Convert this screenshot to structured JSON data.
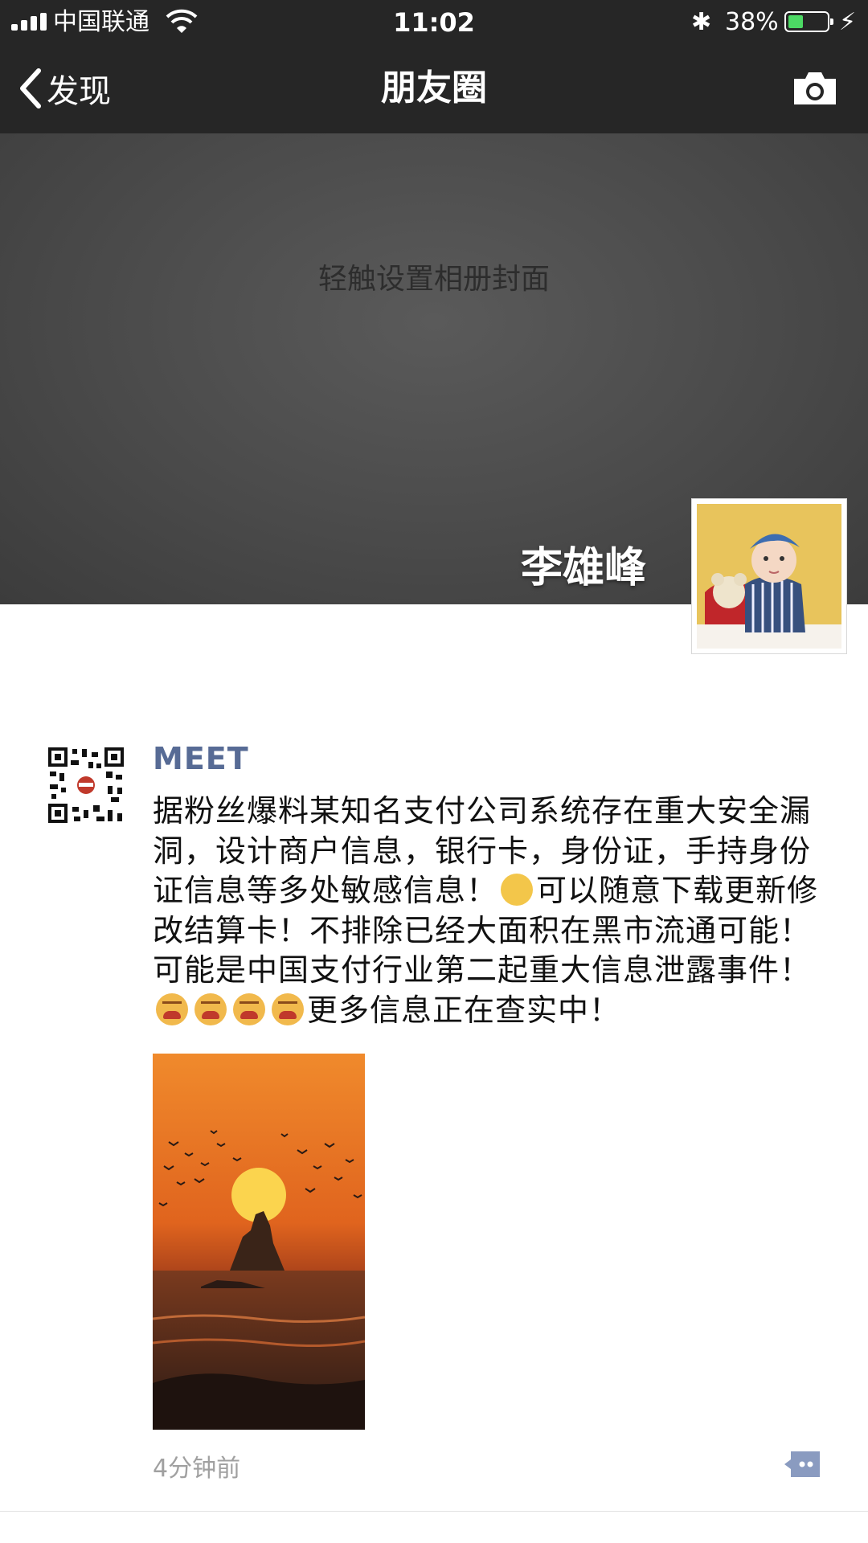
{
  "status_bar": {
    "carrier": "中国联通",
    "time": "11:02",
    "battery_percent": "38%",
    "battery_level": 0.38,
    "icons": [
      "signal-icon",
      "wifi-icon",
      "bluetooth-icon",
      "battery-icon",
      "charging-icon"
    ]
  },
  "nav": {
    "back_label": "发现",
    "title": "朋友圈",
    "right_icon": "camera-icon"
  },
  "cover": {
    "hint": "轻触设置相册封面",
    "user_name": "李雄峰"
  },
  "post": {
    "author": "MEET",
    "text_part1": "据粉丝爆料某知名支付公司系统存在重大安全漏洞，设计商户信息，银行卡，身份证，手持身份证信息等多处敏感信息！",
    "text_part2": "可以随意下载更新修改结算卡！不排除已经大面积在黑市流通可能！可能是中国支付行业第二起重大信息泄露事件！",
    "text_part3": "更多信息正在查实中！",
    "emojis": [
      "dizzy-emoji",
      "angry-emoji",
      "angry-emoji",
      "angry-emoji",
      "angry-emoji"
    ],
    "time": "4分钟前",
    "colors": {
      "author": "#576b95",
      "time": "#a0a0a0"
    }
  }
}
